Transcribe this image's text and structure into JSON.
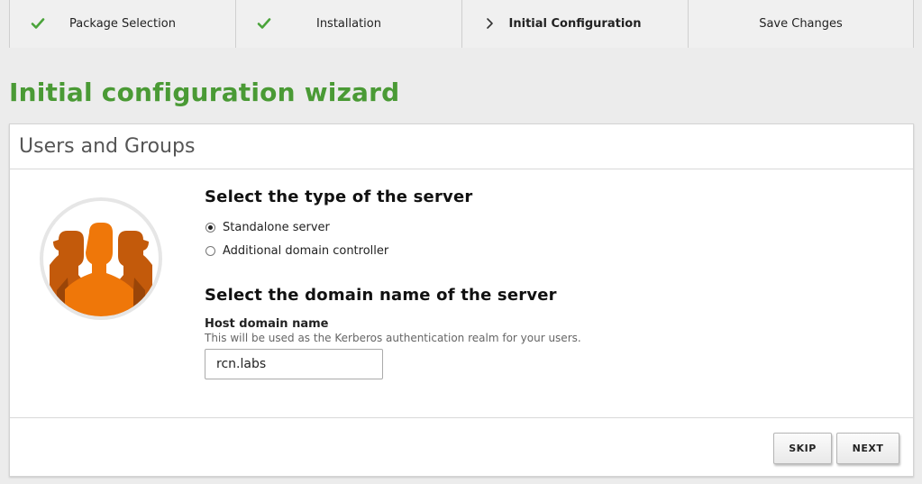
{
  "steps": [
    {
      "label": "Package Selection",
      "status": "done",
      "icon": "check-icon"
    },
    {
      "label": "Installation",
      "status": "done",
      "icon": "check-icon"
    },
    {
      "label": "Initial Configuration",
      "status": "current",
      "icon": "chevron-right-icon"
    },
    {
      "label": "Save Changes",
      "status": "pending",
      "icon": ""
    }
  ],
  "wizard": {
    "title": "Initial configuration wizard"
  },
  "panel": {
    "title": "Users and Groups",
    "avatar_icon": "users-group-icon",
    "server_type": {
      "heading": "Select the type of the server",
      "options": [
        {
          "label": "Standalone server",
          "checked": true
        },
        {
          "label": "Additional domain controller",
          "checked": false
        }
      ]
    },
    "domain": {
      "heading": "Select the domain name of the server",
      "field_label": "Host domain name",
      "field_help": "This will be used as the Kerberos authentication realm for your users.",
      "value": "rcn.labs"
    },
    "buttons": {
      "skip": "SKIP",
      "next": "NEXT"
    }
  },
  "colors": {
    "accent_green": "#4a9a35",
    "avatar_orange": "#ef7709",
    "avatar_dark_orange": "#c55a0a"
  }
}
